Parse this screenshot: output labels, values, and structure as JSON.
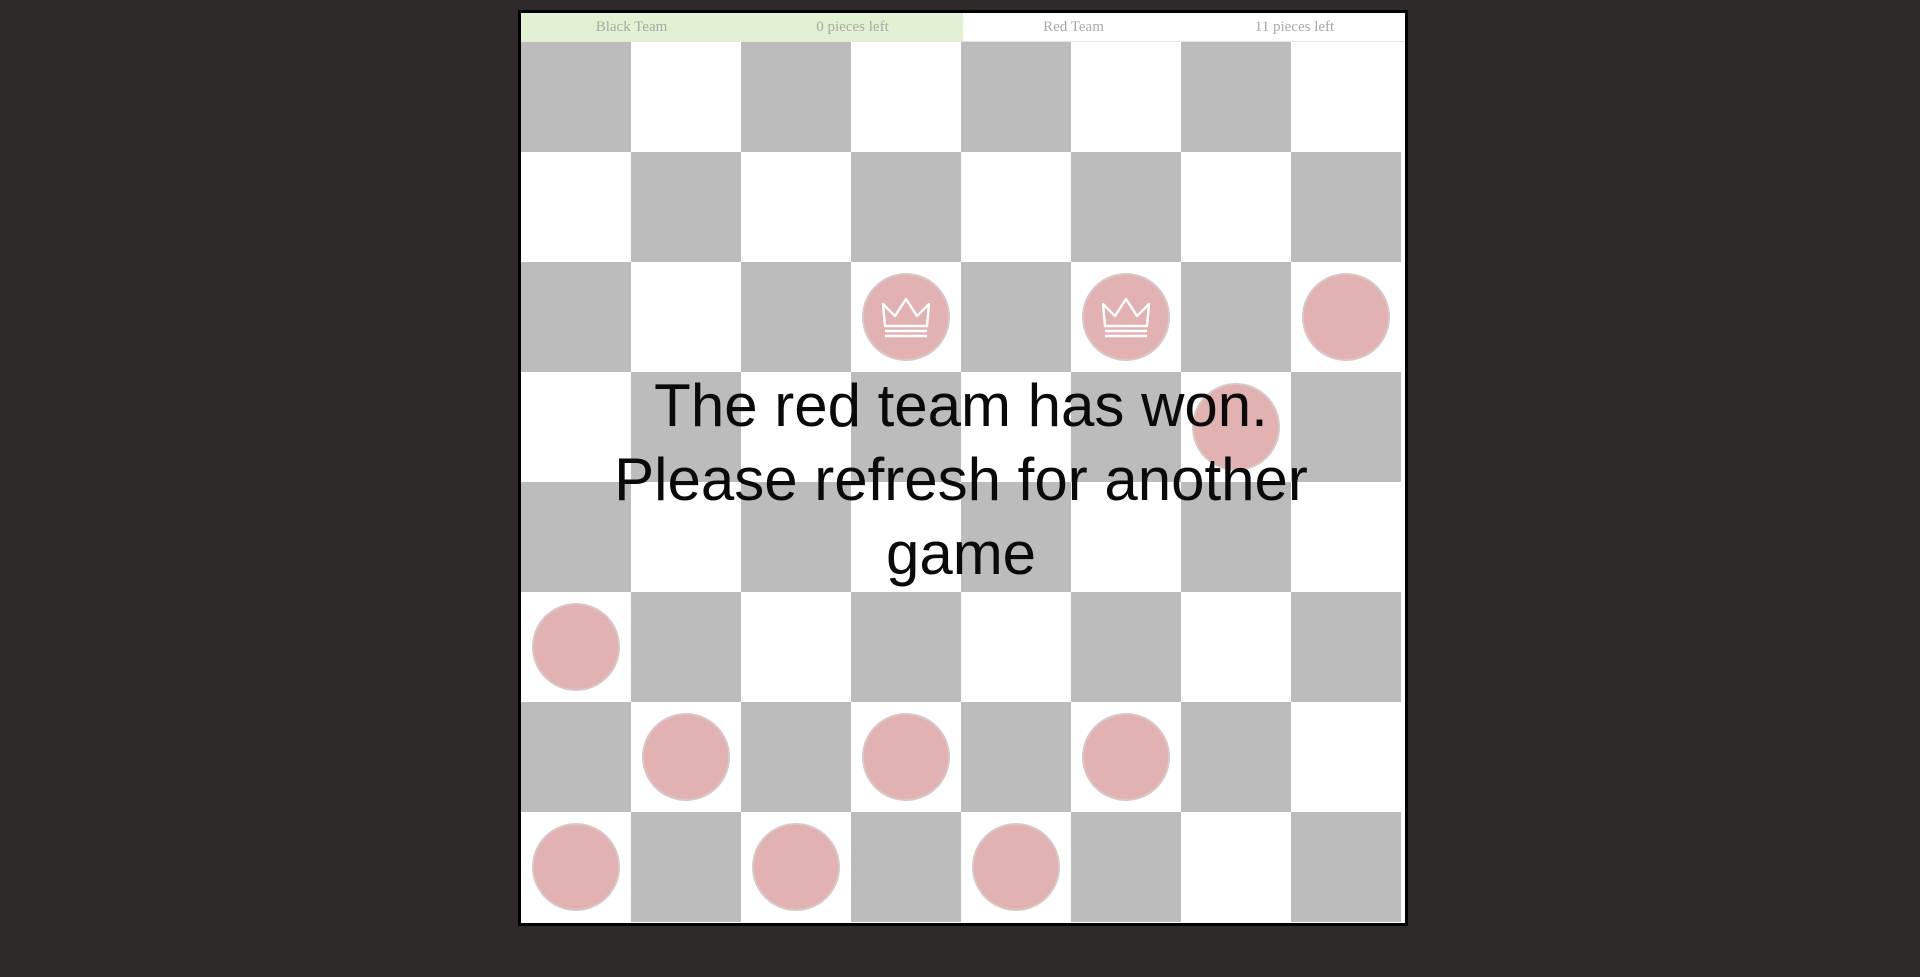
{
  "scoreboard": {
    "black_team": {
      "name": "Black Team",
      "pieces_left": "0 pieces left",
      "active": true
    },
    "red_team": {
      "name": "Red Team",
      "pieces_left": "11 pieces left",
      "active": false
    }
  },
  "colors": {
    "page_background": "#2e2a29",
    "dark_square": "#bcbcbc",
    "light_square": "#ffffff",
    "red_piece": "#e2b1b1",
    "active_team_highlight": "#e3f1d3"
  },
  "board": {
    "size": 8,
    "pieces": [
      {
        "row": 2,
        "col": 3,
        "team": "red",
        "king": true
      },
      {
        "row": 2,
        "col": 5,
        "team": "red",
        "king": true
      },
      {
        "row": 2,
        "col": 7,
        "team": "red",
        "king": false
      },
      {
        "row": 3,
        "col": 6,
        "team": "red",
        "king": false
      },
      {
        "row": 5,
        "col": 0,
        "team": "red",
        "king": false
      },
      {
        "row": 6,
        "col": 1,
        "team": "red",
        "king": false
      },
      {
        "row": 6,
        "col": 3,
        "team": "red",
        "king": false
      },
      {
        "row": 6,
        "col": 5,
        "team": "red",
        "king": false
      },
      {
        "row": 7,
        "col": 0,
        "team": "red",
        "king": false
      },
      {
        "row": 7,
        "col": 2,
        "team": "red",
        "king": false
      },
      {
        "row": 7,
        "col": 4,
        "team": "red",
        "king": false
      }
    ]
  },
  "message": {
    "line1": "The red team has won.",
    "line2": "Please refresh for another",
    "line3": "game"
  }
}
